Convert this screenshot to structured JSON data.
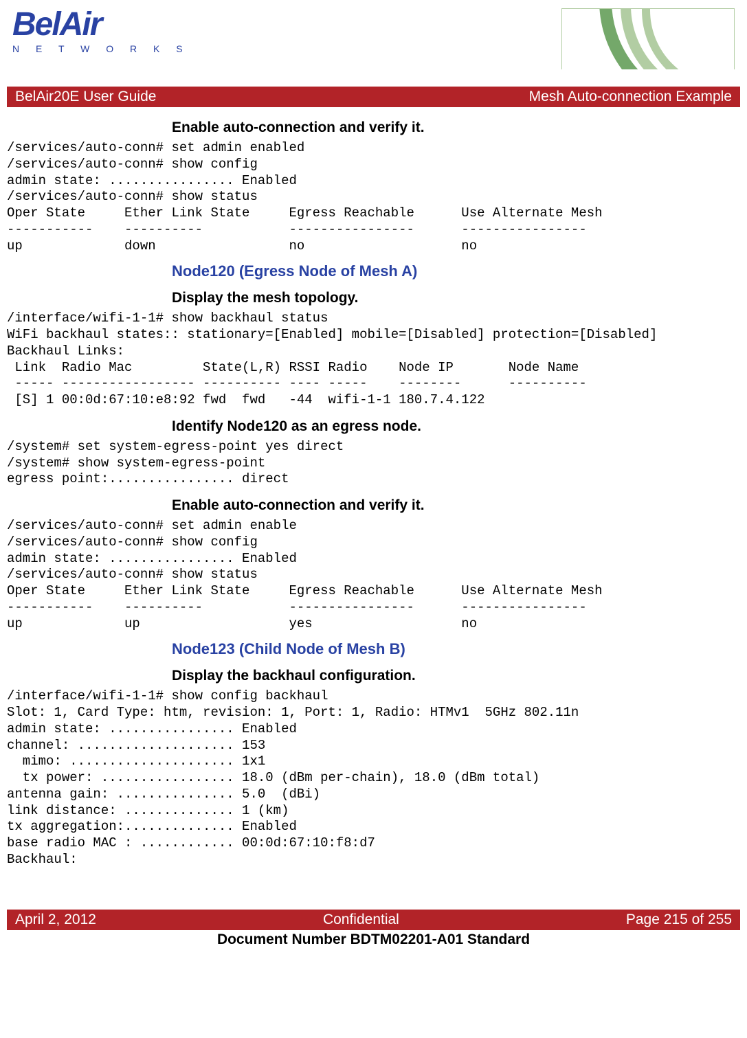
{
  "logo": {
    "brand": "BelAir",
    "sub": "N E T W O R K S"
  },
  "header": {
    "left": "BelAir20E User Guide",
    "right": "Mesh Auto-connection Example"
  },
  "sections": [
    {
      "instr": "Enable auto-connection and verify it.",
      "term": "/services/auto-conn# set admin enabled\n/services/auto-conn# show config\nadmin state: ................ Enabled\n/services/auto-conn# show status\nOper State     Ether Link State     Egress Reachable      Use Alternate Mesh\n-----------    ----------           ----------------      ----------------\nup             down                 no                    no"
    },
    {
      "heading": "Node120 (Egress Node of Mesh A)",
      "instr": "Display the mesh topology.",
      "term": "/interface/wifi-1-1# show backhaul status\nWiFi backhaul states:: stationary=[Enabled] mobile=[Disabled] protection=[Disabled]\nBackhaul Links:\n Link  Radio Mac         State(L,R) RSSI Radio    Node IP       Node Name\n ----- ----------------- ---------- ---- -----    --------      ----------\n [S] 1 00:0d:67:10:e8:92 fwd  fwd   -44  wifi-1-1 180.7.4.122"
    },
    {
      "instr": "Identify Node120 as an egress node.",
      "term": "/system# set system-egress-point yes direct\n/system# show system-egress-point\negress point:................ direct"
    },
    {
      "instr": "Enable auto-connection and verify it.",
      "term": "/services/auto-conn# set admin enable\n/services/auto-conn# show config\nadmin state: ................ Enabled\n/services/auto-conn# show status\nOper State     Ether Link State     Egress Reachable      Use Alternate Mesh\n-----------    ----------           ----------------      ----------------\nup             up                   yes                   no"
    },
    {
      "heading": "Node123 (Child Node of Mesh B)",
      "instr": "Display the backhaul configuration.",
      "term": "/interface/wifi-1-1# show config backhaul\nSlot: 1, Card Type: htm, revision: 1, Port: 1, Radio: HTMv1  5GHz 802.11n\nadmin state: ................ Enabled\nchannel: .................... 153\n  mimo: ..................... 1x1\n  tx power: ................. 18.0 (dBm per-chain), 18.0 (dBm total)\nantenna gain: ............... 5.0  (dBi)\nlink distance: .............. 1 (km)\ntx aggregation:.............. Enabled\nbase radio MAC : ............ 00:0d:67:10:f8:d7\nBackhaul:"
    }
  ],
  "footer": {
    "left": "April 2, 2012",
    "center": "Confidential",
    "right": "Page 215 of 255"
  },
  "docnum": "Document Number BDTM02201-A01 Standard"
}
